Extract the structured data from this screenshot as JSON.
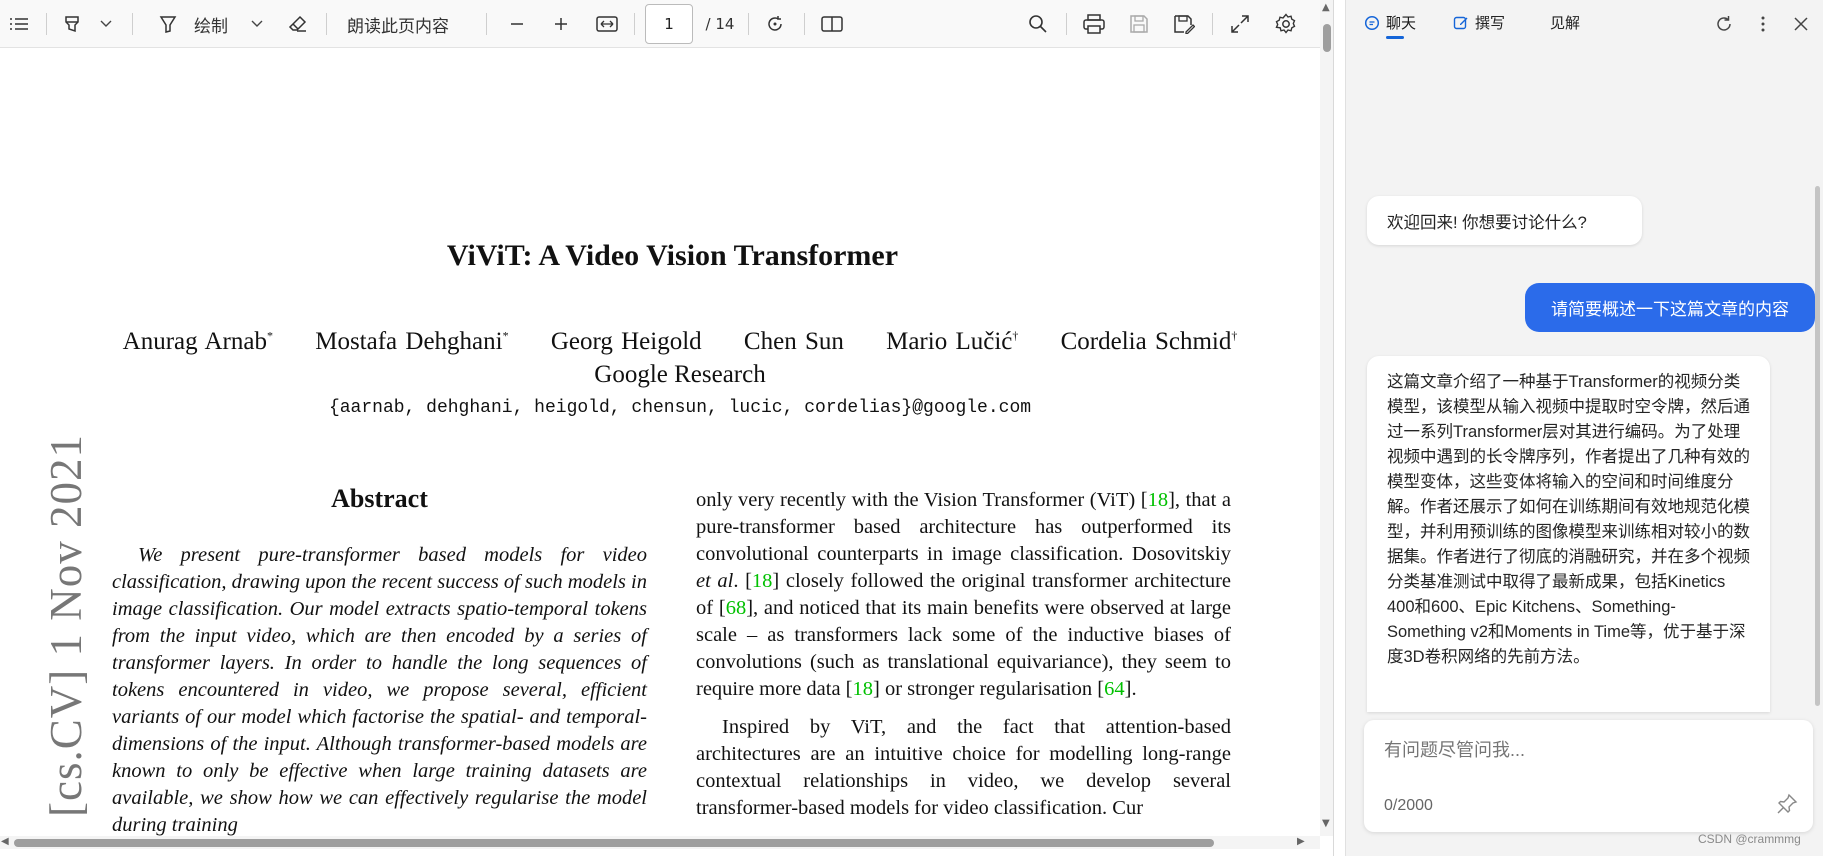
{
  "toolbar": {
    "draw_label": "绘制",
    "read_aloud_label": "朗读此页内容",
    "page_current": "1",
    "page_total": "/ 14"
  },
  "paper": {
    "title": "ViViT: A Video Vision Transformer",
    "authors": [
      {
        "name": "Anurag Arnab",
        "mark": "*"
      },
      {
        "name": "Mostafa Dehghani",
        "mark": "*"
      },
      {
        "name": "Georg Heigold",
        "mark": ""
      },
      {
        "name": "Chen Sun",
        "mark": ""
      },
      {
        "name": "Mario Lučić",
        "mark": "†"
      },
      {
        "name": "Cordelia Schmid",
        "mark": "†"
      }
    ],
    "affiliation": "Google Research",
    "emails": "{aarnab, dehghani, heigold, chensun, lucic, cordelias}@google.com",
    "abstract_heading": "Abstract",
    "abstract_text": "We present pure-transformer based models for video classification, drawing upon the recent success of such models in image classification. Our model extracts spatio-temporal tokens from the input video, which are then encoded by a series of transformer layers. In order to handle the long sequences of tokens encountered in video, we propose several, efficient variants of our model which factorise the spatial- and temporal-dimensions of the input. Although transformer-based models are known to only be effective when large training datasets are available, we show how we can effectively regularise the model during training",
    "col2_p1": [
      {
        "t": "only very recently with the Vision Transformer (ViT) ["
      },
      {
        "t": "18",
        "c": true
      },
      {
        "t": "], that a pure-transformer based architecture has outperformed its convolutional counterparts in image classification. Dosovitskiy "
      },
      {
        "t": "et al",
        "i": true
      },
      {
        "t": ". ["
      },
      {
        "t": "18",
        "c": true
      },
      {
        "t": "] closely followed the original transformer architecture of ["
      },
      {
        "t": "68",
        "c": true
      },
      {
        "t": "], and noticed that its main benefits were observed at large scale – as transformers lack some of the inductive biases of convolutions (such as translational equivariance), they seem to require more data ["
      },
      {
        "t": "18",
        "c": true
      },
      {
        "t": "] or stronger regularisation ["
      },
      {
        "t": "64",
        "c": true
      },
      {
        "t": "]."
      }
    ],
    "col2_p2": "Inspired by ViT, and the fact that attention-based architectures are an intuitive choice for modelling long-range contextual relationships in video, we develop several transformer-based models for video classification. Cur",
    "arxiv_stamp": "[cs.CV]  1 Nov 2021"
  },
  "sidebar": {
    "tabs": [
      {
        "label": "聊天",
        "icon": "chat-icon",
        "active": true
      },
      {
        "label": "撰写",
        "icon": "compose-icon",
        "active": false
      },
      {
        "label": "见解",
        "icon": "",
        "active": false
      }
    ],
    "messages": {
      "greeting": "欢迎回来! 你想要讨论什么?",
      "user": "请简要概述一下这篇文章的内容",
      "answer": "这篇文章介绍了一种基于Transformer的视频分类模型，该模型从输入视频中提取时空令牌，然后通过一系列Transformer层对其进行编码。为了处理视频中遇到的长令牌序列，作者提出了几种有效的模型变体，这些变体将输入的空间和时间维度分解。作者还展示了如何在训练期间有效地规范化模型，并利用预训练的图像模型来训练相对较小的数据集。作者进行了彻底的消融研究，并在多个视频分类基准测试中取得了最新成果，包括Kinetics 400和600、Epic Kitchens、Something-Something v2和Moments in Time等，优于基于深度3D卷积网络的先前方法。"
    },
    "input": {
      "placeholder": "有问题尽管问我...",
      "counter": "0/2000"
    }
  },
  "watermark": "CSDN @crammmg",
  "colors": {
    "accent": "#2b6bea",
    "citation": "#00c000",
    "tab_underline": "#1565d8"
  }
}
